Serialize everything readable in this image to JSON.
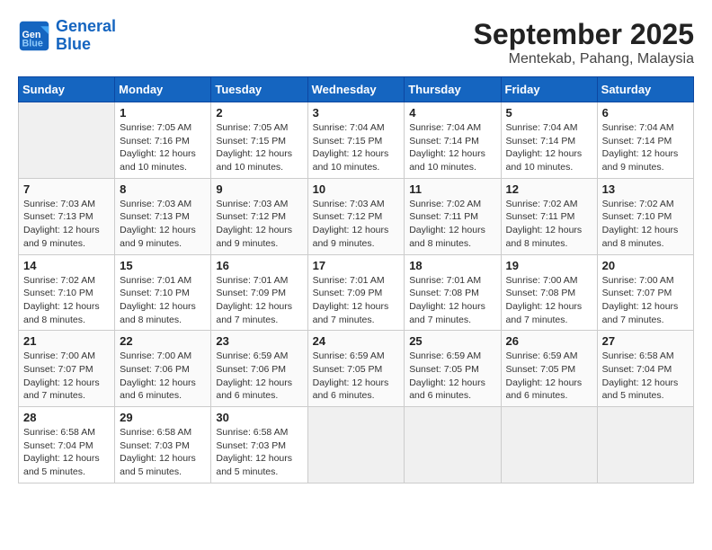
{
  "header": {
    "logo_line1": "General",
    "logo_line2": "Blue",
    "month": "September 2025",
    "location": "Mentekab, Pahang, Malaysia"
  },
  "weekdays": [
    "Sunday",
    "Monday",
    "Tuesday",
    "Wednesday",
    "Thursday",
    "Friday",
    "Saturday"
  ],
  "weeks": [
    [
      {
        "day": "",
        "info": ""
      },
      {
        "day": "1",
        "info": "Sunrise: 7:05 AM\nSunset: 7:16 PM\nDaylight: 12 hours\nand 10 minutes."
      },
      {
        "day": "2",
        "info": "Sunrise: 7:05 AM\nSunset: 7:15 PM\nDaylight: 12 hours\nand 10 minutes."
      },
      {
        "day": "3",
        "info": "Sunrise: 7:04 AM\nSunset: 7:15 PM\nDaylight: 12 hours\nand 10 minutes."
      },
      {
        "day": "4",
        "info": "Sunrise: 7:04 AM\nSunset: 7:14 PM\nDaylight: 12 hours\nand 10 minutes."
      },
      {
        "day": "5",
        "info": "Sunrise: 7:04 AM\nSunset: 7:14 PM\nDaylight: 12 hours\nand 10 minutes."
      },
      {
        "day": "6",
        "info": "Sunrise: 7:04 AM\nSunset: 7:14 PM\nDaylight: 12 hours\nand 9 minutes."
      }
    ],
    [
      {
        "day": "7",
        "info": "Sunrise: 7:03 AM\nSunset: 7:13 PM\nDaylight: 12 hours\nand 9 minutes."
      },
      {
        "day": "8",
        "info": "Sunrise: 7:03 AM\nSunset: 7:13 PM\nDaylight: 12 hours\nand 9 minutes."
      },
      {
        "day": "9",
        "info": "Sunrise: 7:03 AM\nSunset: 7:12 PM\nDaylight: 12 hours\nand 9 minutes."
      },
      {
        "day": "10",
        "info": "Sunrise: 7:03 AM\nSunset: 7:12 PM\nDaylight: 12 hours\nand 9 minutes."
      },
      {
        "day": "11",
        "info": "Sunrise: 7:02 AM\nSunset: 7:11 PM\nDaylight: 12 hours\nand 8 minutes."
      },
      {
        "day": "12",
        "info": "Sunrise: 7:02 AM\nSunset: 7:11 PM\nDaylight: 12 hours\nand 8 minutes."
      },
      {
        "day": "13",
        "info": "Sunrise: 7:02 AM\nSunset: 7:10 PM\nDaylight: 12 hours\nand 8 minutes."
      }
    ],
    [
      {
        "day": "14",
        "info": "Sunrise: 7:02 AM\nSunset: 7:10 PM\nDaylight: 12 hours\nand 8 minutes."
      },
      {
        "day": "15",
        "info": "Sunrise: 7:01 AM\nSunset: 7:10 PM\nDaylight: 12 hours\nand 8 minutes."
      },
      {
        "day": "16",
        "info": "Sunrise: 7:01 AM\nSunset: 7:09 PM\nDaylight: 12 hours\nand 7 minutes."
      },
      {
        "day": "17",
        "info": "Sunrise: 7:01 AM\nSunset: 7:09 PM\nDaylight: 12 hours\nand 7 minutes."
      },
      {
        "day": "18",
        "info": "Sunrise: 7:01 AM\nSunset: 7:08 PM\nDaylight: 12 hours\nand 7 minutes."
      },
      {
        "day": "19",
        "info": "Sunrise: 7:00 AM\nSunset: 7:08 PM\nDaylight: 12 hours\nand 7 minutes."
      },
      {
        "day": "20",
        "info": "Sunrise: 7:00 AM\nSunset: 7:07 PM\nDaylight: 12 hours\nand 7 minutes."
      }
    ],
    [
      {
        "day": "21",
        "info": "Sunrise: 7:00 AM\nSunset: 7:07 PM\nDaylight: 12 hours\nand 7 minutes."
      },
      {
        "day": "22",
        "info": "Sunrise: 7:00 AM\nSunset: 7:06 PM\nDaylight: 12 hours\nand 6 minutes."
      },
      {
        "day": "23",
        "info": "Sunrise: 6:59 AM\nSunset: 7:06 PM\nDaylight: 12 hours\nand 6 minutes."
      },
      {
        "day": "24",
        "info": "Sunrise: 6:59 AM\nSunset: 7:05 PM\nDaylight: 12 hours\nand 6 minutes."
      },
      {
        "day": "25",
        "info": "Sunrise: 6:59 AM\nSunset: 7:05 PM\nDaylight: 12 hours\nand 6 minutes."
      },
      {
        "day": "26",
        "info": "Sunrise: 6:59 AM\nSunset: 7:05 PM\nDaylight: 12 hours\nand 6 minutes."
      },
      {
        "day": "27",
        "info": "Sunrise: 6:58 AM\nSunset: 7:04 PM\nDaylight: 12 hours\nand 5 minutes."
      }
    ],
    [
      {
        "day": "28",
        "info": "Sunrise: 6:58 AM\nSunset: 7:04 PM\nDaylight: 12 hours\nand 5 minutes."
      },
      {
        "day": "29",
        "info": "Sunrise: 6:58 AM\nSunset: 7:03 PM\nDaylight: 12 hours\nand 5 minutes."
      },
      {
        "day": "30",
        "info": "Sunrise: 6:58 AM\nSunset: 7:03 PM\nDaylight: 12 hours\nand 5 minutes."
      },
      {
        "day": "",
        "info": ""
      },
      {
        "day": "",
        "info": ""
      },
      {
        "day": "",
        "info": ""
      },
      {
        "day": "",
        "info": ""
      }
    ]
  ]
}
